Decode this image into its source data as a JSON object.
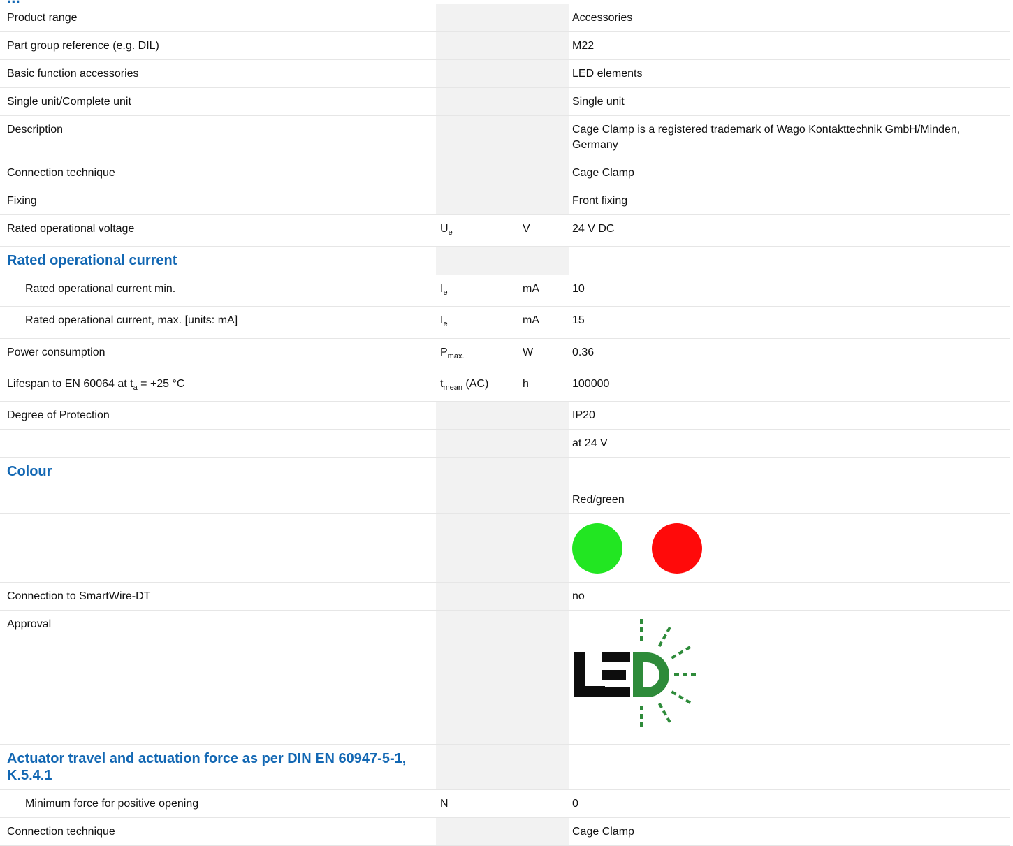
{
  "heading_fragment": "...",
  "rows": {
    "product_range": {
      "label": "Product range",
      "value": "Accessories"
    },
    "part_group": {
      "label": "Part group reference (e.g. DIL)",
      "value": "M22"
    },
    "basic_function": {
      "label": "Basic function accessories",
      "value": "LED elements"
    },
    "single_unit": {
      "label": "Single unit/Complete unit",
      "value": "Single unit"
    },
    "description": {
      "label": "Description",
      "value": "Cage Clamp is a registered trademark of Wago Kontakttechnik GmbH/Minden, Germany"
    },
    "connection_technique": {
      "label": "Connection technique",
      "value": "Cage Clamp"
    },
    "fixing": {
      "label": "Fixing",
      "value": "Front fixing"
    },
    "rated_voltage": {
      "label": "Rated operational voltage",
      "symbol": "U",
      "symbol_sub": "e",
      "unit": "V",
      "value": "24 V DC"
    },
    "rated_current_header": {
      "label": "Rated operational current"
    },
    "current_min": {
      "label": "Rated operational current min.",
      "symbol": "I",
      "symbol_sub": "e",
      "unit": "mA",
      "value": "10"
    },
    "current_max": {
      "label": "Rated operational current, max. [units: mA]",
      "symbol": "I",
      "symbol_sub": "e",
      "unit": "mA",
      "value": "15"
    },
    "power": {
      "label": "Power consumption",
      "symbol": "P",
      "symbol_sub": "max.",
      "unit": "W",
      "value": "0.36"
    },
    "lifespan": {
      "label_pre": "Lifespan to EN 60064 at t",
      "label_sub": "a",
      "label_post": " = +25 °C",
      "symbol": "t",
      "symbol_sub": "mean",
      "symbol_post": " (AC)",
      "unit": "h",
      "value": "100000"
    },
    "protection": {
      "label": "Degree of Protection",
      "value": "IP20"
    },
    "at24": {
      "label": "",
      "value": "at 24 V"
    },
    "colour_header": {
      "label": "Colour"
    },
    "colour": {
      "label": "",
      "value": "Red/green"
    },
    "smartwire": {
      "label": "Connection to SmartWire-DT",
      "value": "no"
    },
    "approval": {
      "label": "Approval",
      "logo_text": "LED"
    },
    "actuator_header": {
      "label": "Actuator travel and actuation force as per DIN EN 60947-5-1, K.5.4.1"
    },
    "min_force": {
      "label": "Minimum force for positive opening",
      "symbol": "N",
      "value": "0"
    },
    "connection_technique_2": {
      "label": "Connection technique",
      "value": "Cage Clamp"
    }
  },
  "colors": {
    "heading": "#1267b3",
    "led_green": "#22e622",
    "led_red": "#ff0a0a",
    "logo_green": "#2e8b3a"
  },
  "icons": {
    "green": "green-led-dot-icon",
    "red": "red-led-dot-icon",
    "logo": "led-logo-icon"
  }
}
